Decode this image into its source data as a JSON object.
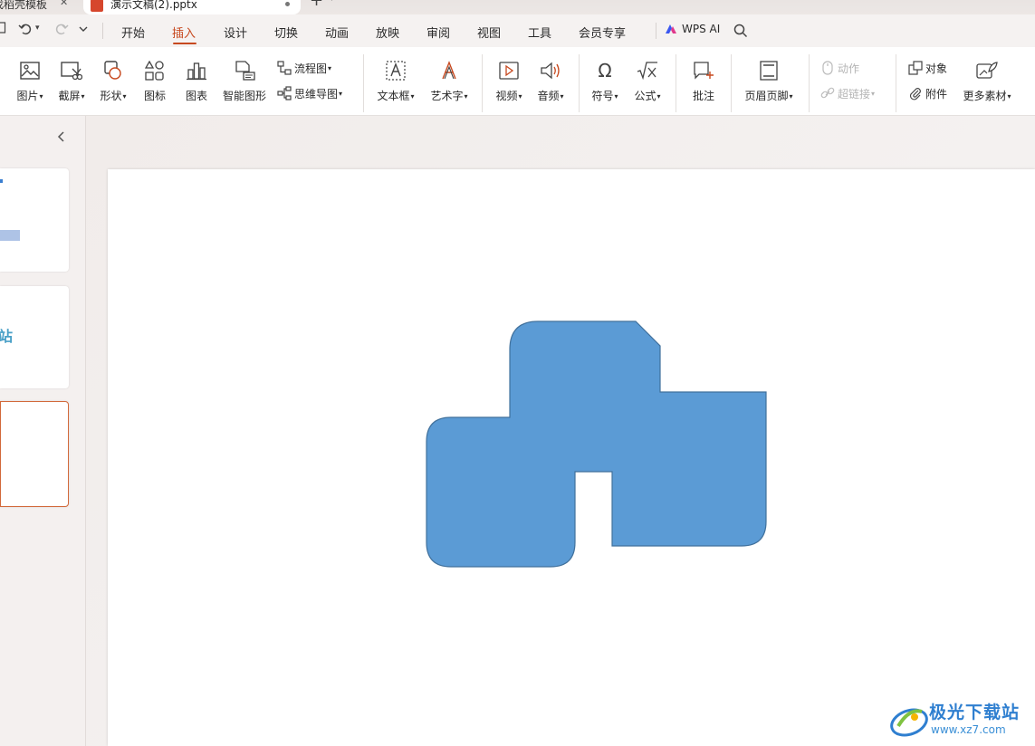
{
  "tabs": {
    "template_tab": "找稻壳模板",
    "doc_tab": "演示文稿(2).pptx"
  },
  "menu": {
    "items": [
      "开始",
      "插入",
      "设计",
      "切换",
      "动画",
      "放映",
      "审阅",
      "视图",
      "工具",
      "会员专享"
    ],
    "active": "插入",
    "wps_ai": "WPS AI"
  },
  "ribbon": {
    "picture": "图片",
    "screenshot": "截屏",
    "shape": "形状",
    "icon": "图标",
    "chart": "图表",
    "smartart": "智能图形",
    "flowchart": "流程图",
    "mindmap": "思维导图",
    "textbox": "文本框",
    "wordart": "艺术字",
    "video": "视频",
    "audio": "音频",
    "symbol": "符号",
    "formula": "公式",
    "comment": "批注",
    "header_footer": "页眉页脚",
    "action": "动作",
    "hyperlink": "超链接",
    "object": "对象",
    "attachment": "附件",
    "more_material": "更多素材"
  },
  "slides": {
    "count": 3,
    "selected": 3,
    "thumb2_text": "站"
  },
  "slide_shape": {
    "fill": "#5b9bd5",
    "stroke": "#41719c"
  },
  "colors": {
    "accent": "#c7491f",
    "selection_border": "#d2693a"
  },
  "watermark": {
    "title": "极光下载站",
    "url": "www.xz7.com"
  }
}
